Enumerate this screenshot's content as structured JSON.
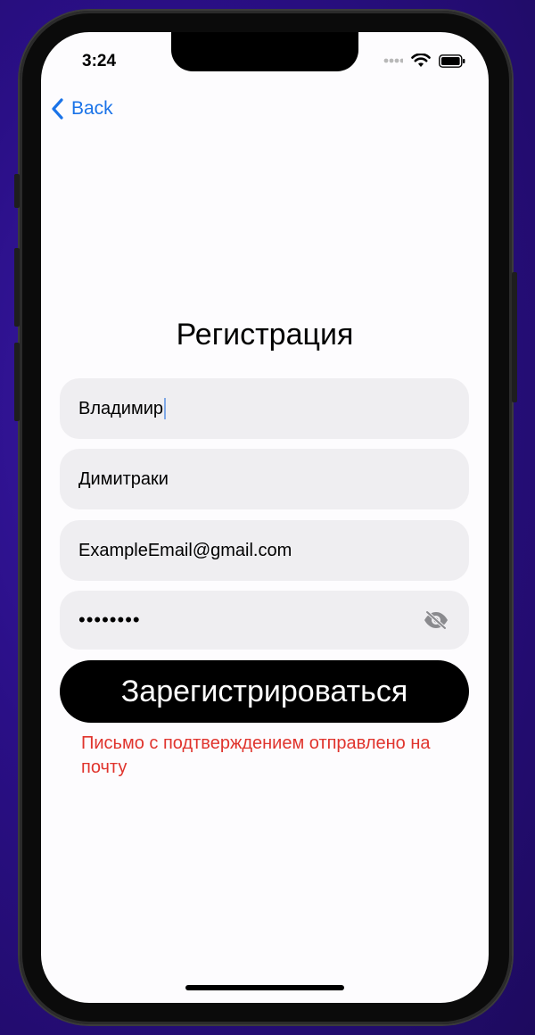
{
  "status_bar": {
    "time": "3:24",
    "icons": [
      "cellular-dots-icon",
      "wifi-icon",
      "battery-icon"
    ]
  },
  "nav": {
    "back_label": "Back",
    "back_icon": "chevron-left-icon"
  },
  "form": {
    "title": "Регистрация",
    "first_name": "Владимир",
    "last_name": "Димитраки",
    "email": "ExampleEmail@gmail.com",
    "password_masked": "••••••••",
    "password_toggle_icon": "eye-slash-icon",
    "submit_label": "Зарегистрироваться",
    "status_message": "Письмо с подтверждением отправлено на почту"
  },
  "colors": {
    "accent": "#1a73e8",
    "error": "#e0342d",
    "field_bg": "#efeef1",
    "button_bg": "#000000"
  }
}
